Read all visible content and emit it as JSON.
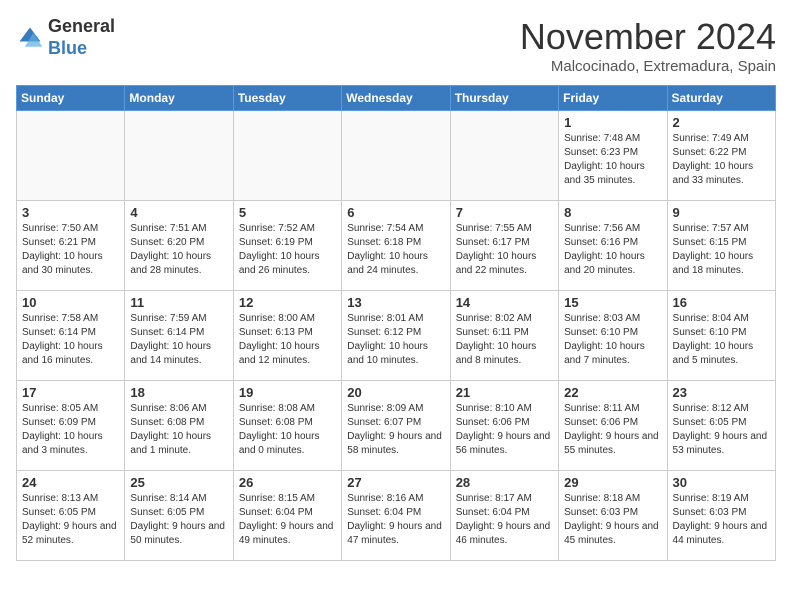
{
  "header": {
    "logo_general": "General",
    "logo_blue": "Blue",
    "month_title": "November 2024",
    "location": "Malcocinado, Extremadura, Spain"
  },
  "weekdays": [
    "Sunday",
    "Monday",
    "Tuesday",
    "Wednesday",
    "Thursday",
    "Friday",
    "Saturday"
  ],
  "weeks": [
    [
      {
        "day": "",
        "info": ""
      },
      {
        "day": "",
        "info": ""
      },
      {
        "day": "",
        "info": ""
      },
      {
        "day": "",
        "info": ""
      },
      {
        "day": "",
        "info": ""
      },
      {
        "day": "1",
        "info": "Sunrise: 7:48 AM\nSunset: 6:23 PM\nDaylight: 10 hours and 35 minutes."
      },
      {
        "day": "2",
        "info": "Sunrise: 7:49 AM\nSunset: 6:22 PM\nDaylight: 10 hours and 33 minutes."
      }
    ],
    [
      {
        "day": "3",
        "info": "Sunrise: 7:50 AM\nSunset: 6:21 PM\nDaylight: 10 hours and 30 minutes."
      },
      {
        "day": "4",
        "info": "Sunrise: 7:51 AM\nSunset: 6:20 PM\nDaylight: 10 hours and 28 minutes."
      },
      {
        "day": "5",
        "info": "Sunrise: 7:52 AM\nSunset: 6:19 PM\nDaylight: 10 hours and 26 minutes."
      },
      {
        "day": "6",
        "info": "Sunrise: 7:54 AM\nSunset: 6:18 PM\nDaylight: 10 hours and 24 minutes."
      },
      {
        "day": "7",
        "info": "Sunrise: 7:55 AM\nSunset: 6:17 PM\nDaylight: 10 hours and 22 minutes."
      },
      {
        "day": "8",
        "info": "Sunrise: 7:56 AM\nSunset: 6:16 PM\nDaylight: 10 hours and 20 minutes."
      },
      {
        "day": "9",
        "info": "Sunrise: 7:57 AM\nSunset: 6:15 PM\nDaylight: 10 hours and 18 minutes."
      }
    ],
    [
      {
        "day": "10",
        "info": "Sunrise: 7:58 AM\nSunset: 6:14 PM\nDaylight: 10 hours and 16 minutes."
      },
      {
        "day": "11",
        "info": "Sunrise: 7:59 AM\nSunset: 6:14 PM\nDaylight: 10 hours and 14 minutes."
      },
      {
        "day": "12",
        "info": "Sunrise: 8:00 AM\nSunset: 6:13 PM\nDaylight: 10 hours and 12 minutes."
      },
      {
        "day": "13",
        "info": "Sunrise: 8:01 AM\nSunset: 6:12 PM\nDaylight: 10 hours and 10 minutes."
      },
      {
        "day": "14",
        "info": "Sunrise: 8:02 AM\nSunset: 6:11 PM\nDaylight: 10 hours and 8 minutes."
      },
      {
        "day": "15",
        "info": "Sunrise: 8:03 AM\nSunset: 6:10 PM\nDaylight: 10 hours and 7 minutes."
      },
      {
        "day": "16",
        "info": "Sunrise: 8:04 AM\nSunset: 6:10 PM\nDaylight: 10 hours and 5 minutes."
      }
    ],
    [
      {
        "day": "17",
        "info": "Sunrise: 8:05 AM\nSunset: 6:09 PM\nDaylight: 10 hours and 3 minutes."
      },
      {
        "day": "18",
        "info": "Sunrise: 8:06 AM\nSunset: 6:08 PM\nDaylight: 10 hours and 1 minute."
      },
      {
        "day": "19",
        "info": "Sunrise: 8:08 AM\nSunset: 6:08 PM\nDaylight: 10 hours and 0 minutes."
      },
      {
        "day": "20",
        "info": "Sunrise: 8:09 AM\nSunset: 6:07 PM\nDaylight: 9 hours and 58 minutes."
      },
      {
        "day": "21",
        "info": "Sunrise: 8:10 AM\nSunset: 6:06 PM\nDaylight: 9 hours and 56 minutes."
      },
      {
        "day": "22",
        "info": "Sunrise: 8:11 AM\nSunset: 6:06 PM\nDaylight: 9 hours and 55 minutes."
      },
      {
        "day": "23",
        "info": "Sunrise: 8:12 AM\nSunset: 6:05 PM\nDaylight: 9 hours and 53 minutes."
      }
    ],
    [
      {
        "day": "24",
        "info": "Sunrise: 8:13 AM\nSunset: 6:05 PM\nDaylight: 9 hours and 52 minutes."
      },
      {
        "day": "25",
        "info": "Sunrise: 8:14 AM\nSunset: 6:05 PM\nDaylight: 9 hours and 50 minutes."
      },
      {
        "day": "26",
        "info": "Sunrise: 8:15 AM\nSunset: 6:04 PM\nDaylight: 9 hours and 49 minutes."
      },
      {
        "day": "27",
        "info": "Sunrise: 8:16 AM\nSunset: 6:04 PM\nDaylight: 9 hours and 47 minutes."
      },
      {
        "day": "28",
        "info": "Sunrise: 8:17 AM\nSunset: 6:04 PM\nDaylight: 9 hours and 46 minutes."
      },
      {
        "day": "29",
        "info": "Sunrise: 8:18 AM\nSunset: 6:03 PM\nDaylight: 9 hours and 45 minutes."
      },
      {
        "day": "30",
        "info": "Sunrise: 8:19 AM\nSunset: 6:03 PM\nDaylight: 9 hours and 44 minutes."
      }
    ]
  ]
}
